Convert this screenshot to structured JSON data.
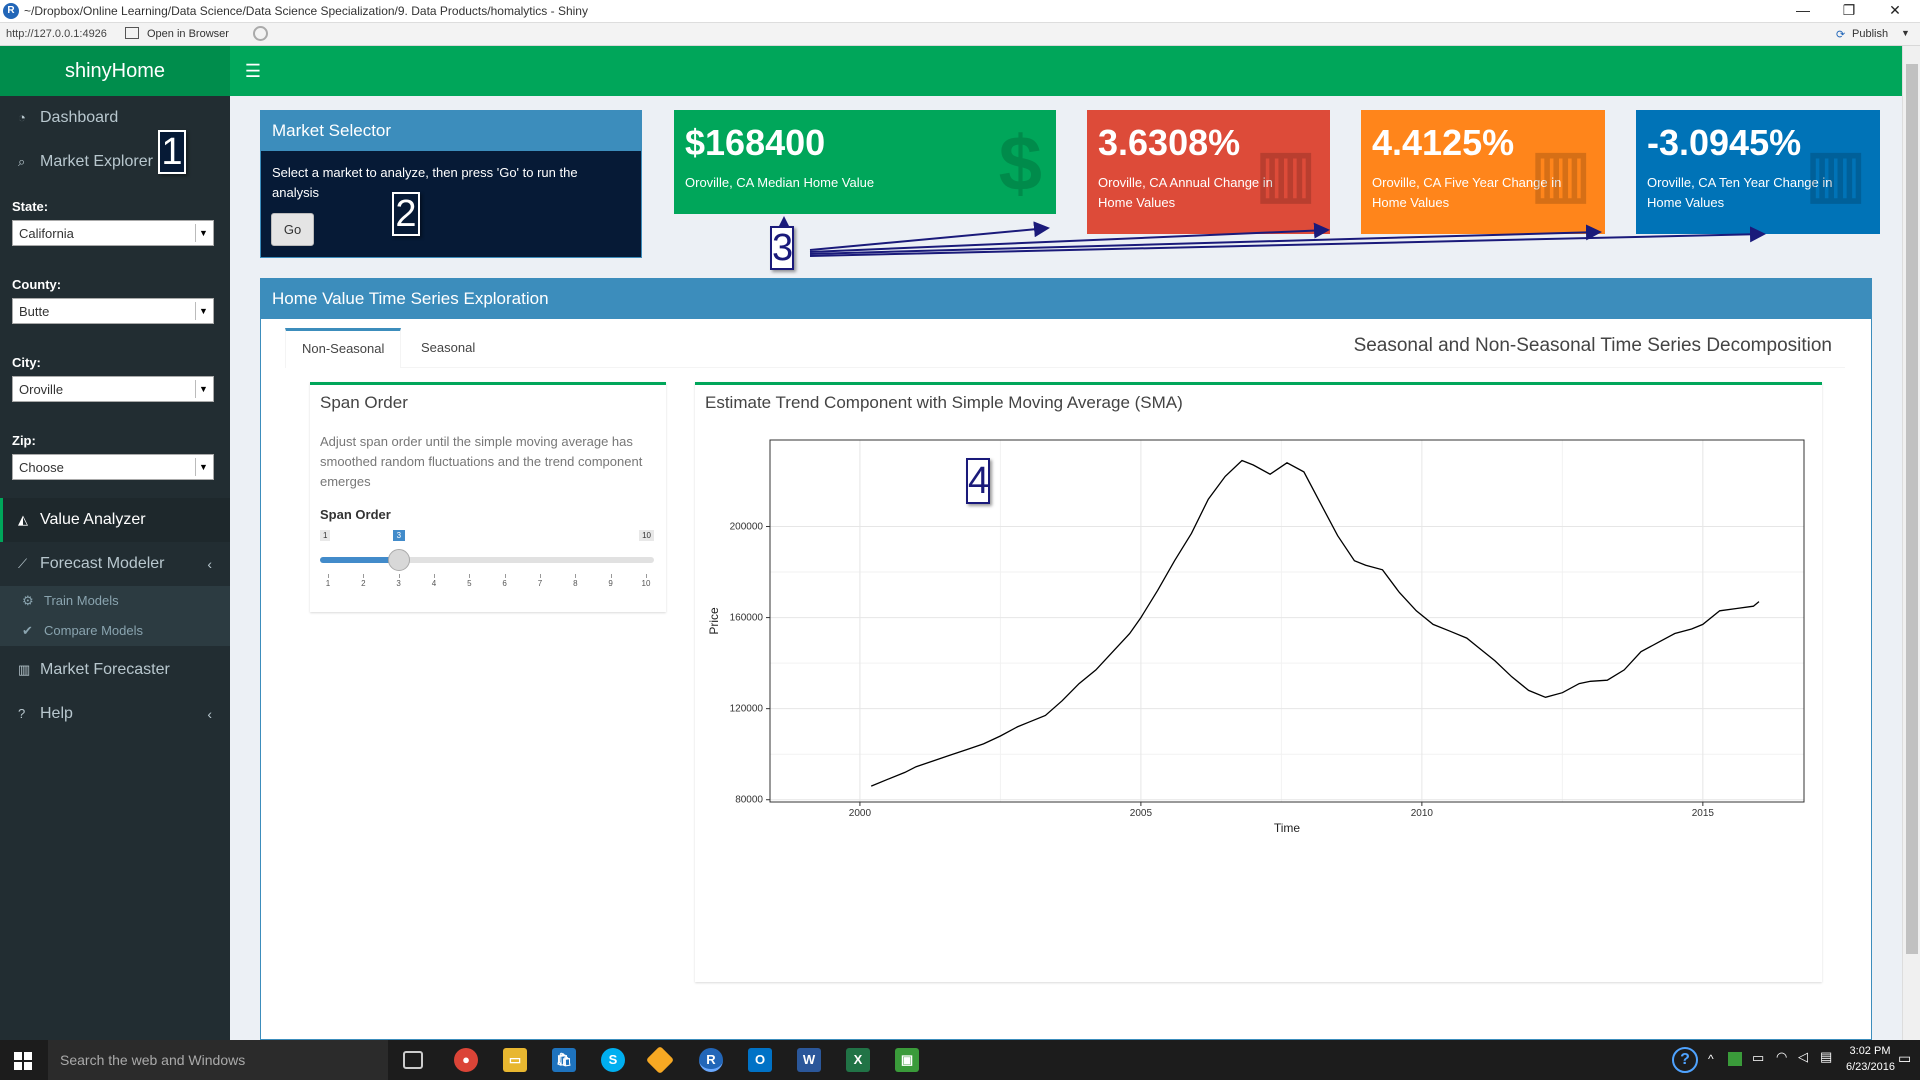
{
  "window": {
    "title": "~/Dropbox/Online Learning/Data Science/Data Science Specialization/9. Data Products/homalytics - Shiny",
    "url": "http://127.0.0.1:4926",
    "open_in_browser": "Open in Browser",
    "publish": "Publish",
    "min": "—",
    "restore": "❐",
    "close": "✕"
  },
  "app": {
    "brand": "shinyHome",
    "menu_icon": "☰"
  },
  "sidebar": {
    "items": [
      {
        "label": "Dashboard",
        "icon": "dashboard-icon"
      },
      {
        "label": "Market Explorer",
        "icon": "search-icon"
      },
      {
        "label": "Value Analyzer",
        "icon": "area-chart-icon"
      },
      {
        "label": "Forecast Modeler",
        "icon": "line-chart-icon"
      },
      {
        "label": "Train Models",
        "icon": "gears-icon"
      },
      {
        "label": "Compare Models",
        "icon": "check-circle-icon"
      },
      {
        "label": "Market Forecaster",
        "icon": "bar-chart-icon"
      },
      {
        "label": "Help",
        "icon": "question-circle-icon"
      }
    ],
    "fields": {
      "state_label": "State:",
      "state_value": "California",
      "county_label": "County:",
      "county_value": "Butte",
      "city_label": "City:",
      "city_value": "Oroville",
      "zip_label": "Zip:",
      "zip_value": "Choose"
    }
  },
  "market_selector": {
    "title": "Market Selector",
    "text": "Select a market to analyze, then press 'Go' to run the analysis",
    "go": "Go"
  },
  "value_boxes": [
    {
      "value": "$168400",
      "label": "Oroville, CA Median Home Value",
      "color": "#00a65a",
      "icon": "dollar-icon"
    },
    {
      "value": "3.6308%",
      "label": "Oroville, CA Annual Change in Home Values",
      "color": "#dd4b39",
      "icon": "bar-chart-icon"
    },
    {
      "value": "4.4125%",
      "label": "Oroville, CA Five Year Change in Home Values",
      "color": "#ff851b",
      "icon": "bar-chart-icon"
    },
    {
      "value": "-3.0945%",
      "label": "Oroville, CA Ten Year Change in Home Values",
      "color": "#0073b7",
      "icon": "bar-chart-icon"
    }
  ],
  "annotations": [
    "1",
    "2",
    "3",
    "4"
  ],
  "ts_box": {
    "title": "Home Value Time Series Exploration",
    "tabs": [
      "Non-Seasonal",
      "Seasonal"
    ],
    "tab_title": "Seasonal and Non-Seasonal Time Series Decomposition"
  },
  "span_panel": {
    "title": "Span Order",
    "help": "Adjust span order until the simple moving average has smoothed random fluctuations and the trend component emerges",
    "slider_label": "Span Order",
    "min": "1",
    "max": "10",
    "value": 3,
    "ticks": [
      "1",
      "2",
      "3",
      "4",
      "5",
      "6",
      "7",
      "8",
      "9",
      "10"
    ]
  },
  "trend_panel": {
    "title": "Estimate Trend Component with Simple Moving Average (SMA)"
  },
  "chart_data": {
    "type": "line",
    "title": "",
    "xlabel": "Time",
    "ylabel": "Price",
    "xlim": [
      1998.4,
      2016.8
    ],
    "ylim": [
      79000,
      238000
    ],
    "xticks": [
      2000,
      2005,
      2010,
      2015
    ],
    "yticks": [
      80000,
      120000,
      160000,
      200000
    ],
    "grid": true,
    "series": [
      {
        "x": [
          2000.2,
          2000.5,
          2000.8,
          2001.0,
          2001.3,
          2001.6,
          2001.9,
          2002.2,
          2002.5,
          2002.8,
          2003.0,
          2003.3,
          2003.6,
          2003.9,
          2004.2,
          2004.5,
          2004.8,
          2005.0,
          2005.3,
          2005.6,
          2005.9,
          2006.2,
          2006.5,
          2006.8,
          2007.0,
          2007.3,
          2007.6,
          2007.9,
          2008.2,
          2008.5,
          2008.8,
          2009.0,
          2009.3,
          2009.6,
          2009.9,
          2010.2,
          2010.5,
          2010.8,
          2011.0,
          2011.3,
          2011.6,
          2011.9,
          2012.2,
          2012.5,
          2012.8,
          2013.0,
          2013.3,
          2013.6,
          2013.9,
          2014.2,
          2014.5,
          2014.8,
          2015.0,
          2015.3,
          2015.6,
          2015.9,
          2016.0
        ],
        "y": [
          86000,
          89000,
          92000,
          94500,
          97000,
          99500,
          102000,
          104500,
          108000,
          112000,
          114000,
          117000,
          123500,
          131000,
          137000,
          145000,
          153000,
          160000,
          172000,
          185000,
          197000,
          212000,
          222000,
          229000,
          227000,
          223000,
          228000,
          224000,
          210000,
          196000,
          185000,
          183000,
          181000,
          171000,
          163000,
          157000,
          154000,
          151000,
          147000,
          141000,
          134000,
          128000,
          125000,
          127000,
          131000,
          132000,
          132500,
          137000,
          145000,
          149000,
          153000,
          155000,
          157000,
          163000,
          164000,
          165000,
          167000
        ]
      }
    ]
  },
  "taskbar": {
    "search": "Search the web and Windows",
    "time": "3:02 PM",
    "date": "6/23/2016"
  }
}
